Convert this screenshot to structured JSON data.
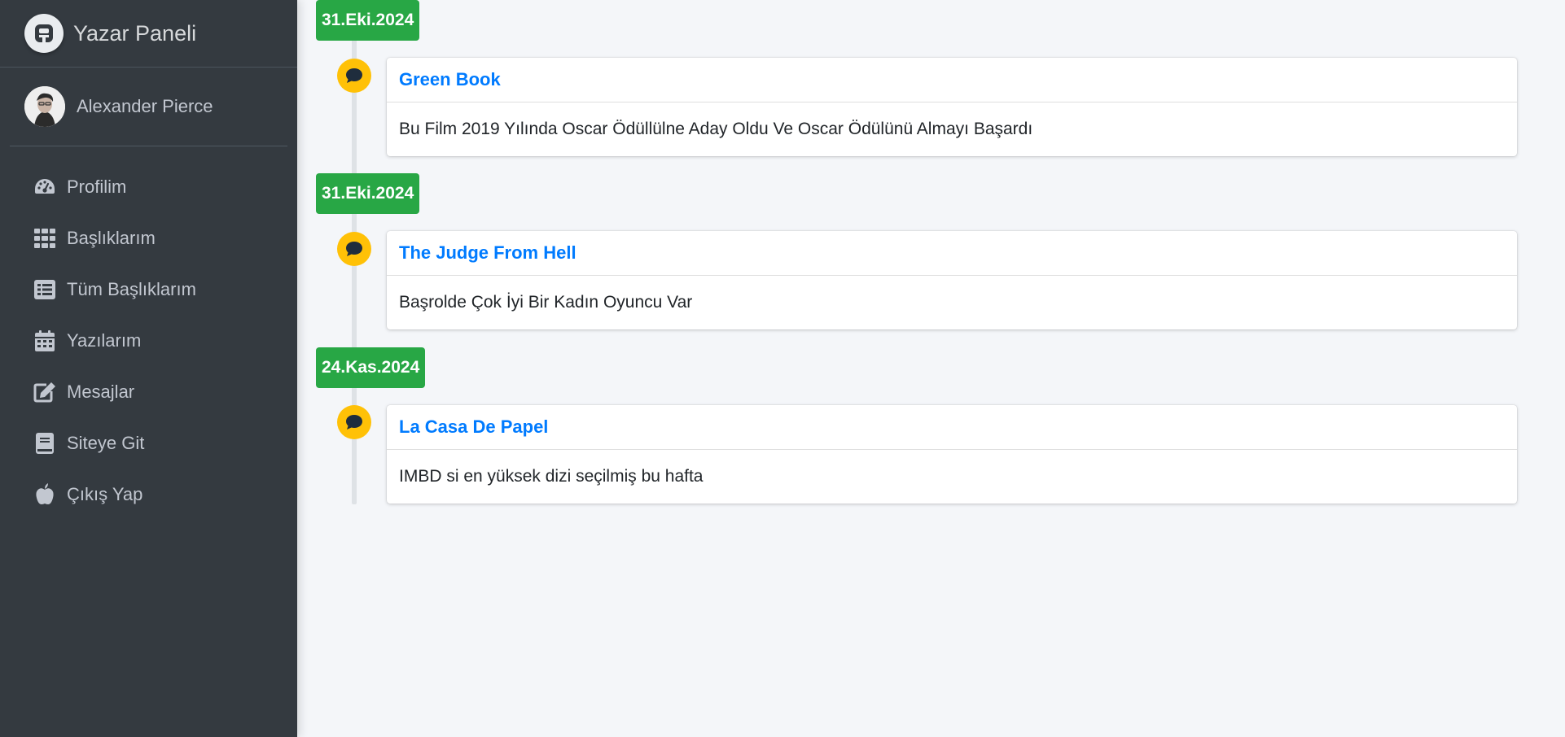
{
  "brand": {
    "title": "Yazar Paneli",
    "logo_icon": "brand-logo-icon"
  },
  "user": {
    "name": "Alexander Pierce"
  },
  "nav": [
    {
      "label": "Profilim",
      "icon": "tachometer-icon"
    },
    {
      "label": "Başlıklarım",
      "icon": "grid-icon"
    },
    {
      "label": "Tüm Başlıklarım",
      "icon": "list-icon"
    },
    {
      "label": "Yazılarım",
      "icon": "calendar-icon"
    },
    {
      "label": "Mesajlar",
      "icon": "edit-icon"
    },
    {
      "label": "Siteye Git",
      "icon": "book-icon"
    },
    {
      "label": "Çıkış Yap",
      "icon": "apple-icon"
    }
  ],
  "timeline": [
    {
      "date": "31.Eki.2024",
      "title": "Green Book",
      "body": "Bu Film 2019 Yılında Oscar Ödüllülne Aday Oldu Ve Oscar Ödülünü Almayı Başardı"
    },
    {
      "date": "31.Eki.2024",
      "title": "The Judge From Hell",
      "body": "Başrolde Çok İyi Bir Kadın Oyuncu Var"
    },
    {
      "date": "24.Kas.2024",
      "title": "La Casa De Papel",
      "body": "IMBD si en yüksek dizi seçilmiş bu hafta"
    }
  ],
  "colors": {
    "sidebar_bg": "#343a40",
    "date_badge": "#28a745",
    "comment_icon_bg": "#ffc107",
    "link": "#007bff",
    "content_bg": "#f4f6f9"
  }
}
